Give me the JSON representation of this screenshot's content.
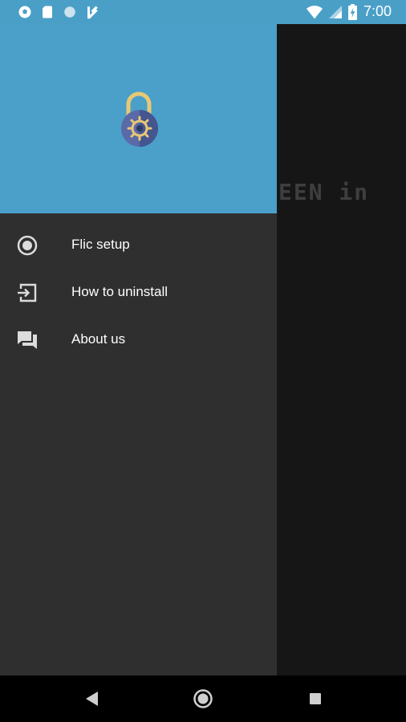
{
  "status_bar": {
    "time": "7:00",
    "left_icons": [
      "soccer-ball-icon",
      "sd-card-icon",
      "circle-icon",
      "feedly-icon"
    ],
    "right_icons": [
      "wifi-icon",
      "signal-icon",
      "battery-icon"
    ]
  },
  "background": {
    "partial_text": "EEN in"
  },
  "drawer": {
    "header_icon": "lock-settings-icon",
    "items": [
      {
        "label": "Flic setup",
        "icon": "radio-button-icon"
      },
      {
        "label": "How to uninstall",
        "icon": "exit-to-app-icon"
      },
      {
        "label": "About us",
        "icon": "chat-bubbles-icon"
      }
    ]
  },
  "nav_bar": {
    "buttons": [
      "back-icon",
      "home-icon",
      "recents-icon"
    ]
  },
  "colors": {
    "header": "#4aa0c9",
    "drawer": "#2f2f2f",
    "lock_shackle": "#e8c874",
    "lock_body": "#5a6aa8",
    "gear": "#e8c874"
  }
}
